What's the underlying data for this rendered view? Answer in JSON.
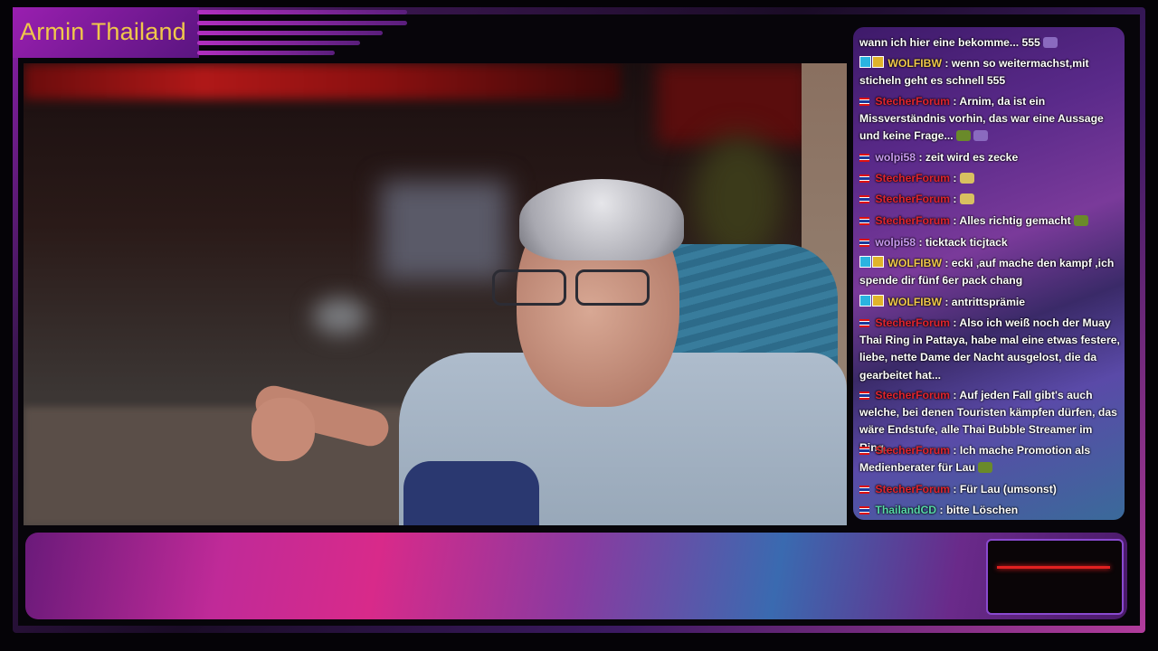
{
  "stream": {
    "title": "Armin Thailand"
  },
  "colors": {
    "title": "#f0c84a",
    "frame_accent": "#9a1fb0",
    "chat_red_user": "#e0242e",
    "chat_wolfibw": "#f0c84a",
    "chat_wolpi58": "#c89af0",
    "chat_thailandcd": "#56d8a8"
  },
  "chat": {
    "messages": [
      {
        "user": "",
        "text": "wann ich hier eine bekomme... 555"
      },
      {
        "user": "WOLFIBW",
        "text": ": wenn so weitermachst,mit sticheln geht es schnell 555"
      },
      {
        "user": "StecherForum",
        "text": ": Arnim, da ist ein Missverständnis vorhin, das war eine Aussage und keine Frage..."
      },
      {
        "user": "wolpi58",
        "text": ": zeit wird es zecke"
      },
      {
        "user": "StecherForum",
        "text": ":"
      },
      {
        "user": "StecherForum",
        "text": ":"
      },
      {
        "user": "StecherForum",
        "text": ": Alles richtig gemacht"
      },
      {
        "user": "wolpi58",
        "text": ": ticktack ticjtack"
      },
      {
        "user": "WOLFIBW",
        "text": ": ecki ,auf mache den kampf ,ich spende dir fünf 6er pack chang"
      },
      {
        "user": "WOLFIBW",
        "text": ": antrittsprämie"
      },
      {
        "user": "StecherForum",
        "text": ": Also ich weiß noch der Muay Thai Ring in Pattaya, habe mal eine etwas festere, liebe, nette Dame der Nacht ausgelost, die da gearbeitet hat..."
      },
      {
        "user": "StecherForum",
        "text": ": Auf jeden Fall gibt's auch welche, bei denen Touristen kämpfen dürfen, das wäre Endstufe, alle Thai Bubble Streamer im Ring..."
      },
      {
        "user": "StecherForum",
        "text": ": Ich mache Promotion als Medienberater für Lau"
      },
      {
        "user": "StecherForum",
        "text": ": Für Lau (umsonst)"
      },
      {
        "user": "ThailandCD",
        "text": ": bitte Löschen"
      }
    ]
  }
}
